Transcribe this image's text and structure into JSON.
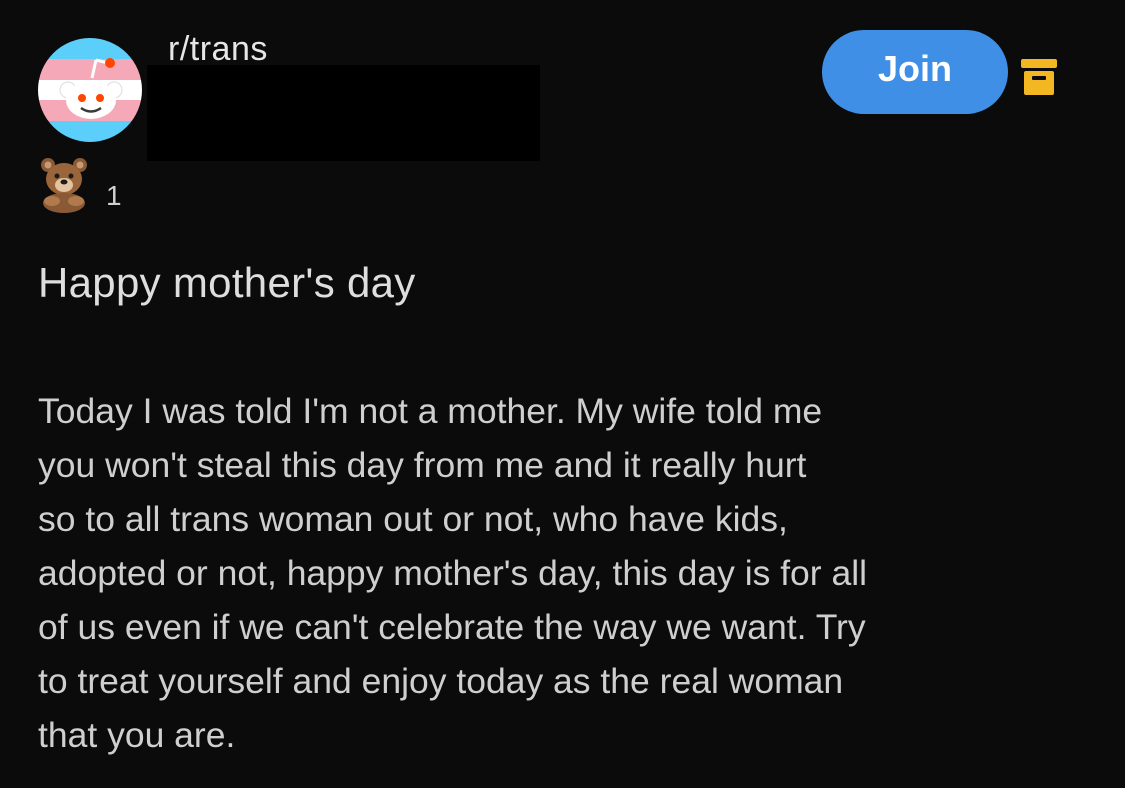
{
  "header": {
    "subreddit": "r/trans",
    "join_label": "Join",
    "avatar_icon": "trans-flag-reddit-snoo-icon",
    "archive_icon": "archive-icon"
  },
  "awards": {
    "icon": "bear-award-icon",
    "count": "1"
  },
  "post": {
    "title": "Happy mother's day",
    "body_lines": [
      "Today I was told I'm not a mother. My wife told me",
      "you won't steal this day from me and it really hurt",
      "so to all trans woman out or not, who have kids,",
      "adopted or not, happy mother's day, this day is for all",
      "of us even if we can't celebrate the way we want. Try",
      "to treat yourself and enjoy today as the real woman",
      "that you are."
    ]
  },
  "colors": {
    "background": "#0b0b0b",
    "join_button": "#3f8fe6",
    "archive_icon": "#f3b722",
    "trans_blue": "#5bcefa",
    "trans_pink": "#f5a9b8"
  }
}
